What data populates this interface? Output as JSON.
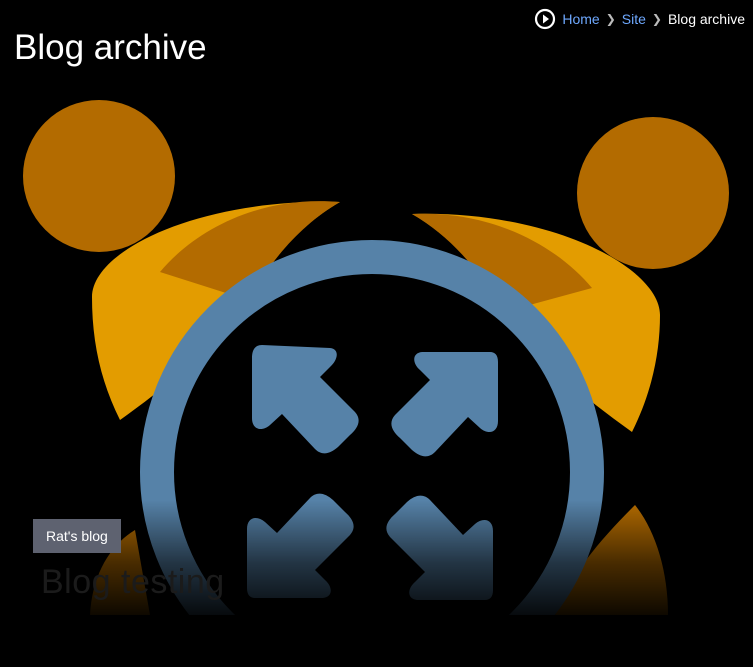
{
  "breadcrumb": {
    "items": [
      {
        "label": "Home"
      },
      {
        "label": "Site"
      },
      {
        "label": "Blog archive"
      }
    ]
  },
  "page": {
    "title": "Blog archive"
  },
  "post": {
    "blog_label": "Rat's blog",
    "title": "Blog testing"
  },
  "hero": {
    "icon": "alarm-clock-fullscreen-icon",
    "colors": {
      "bell_dark": "#b36b00",
      "bell_light": "#e39c00",
      "ring": "#5682a8"
    }
  }
}
